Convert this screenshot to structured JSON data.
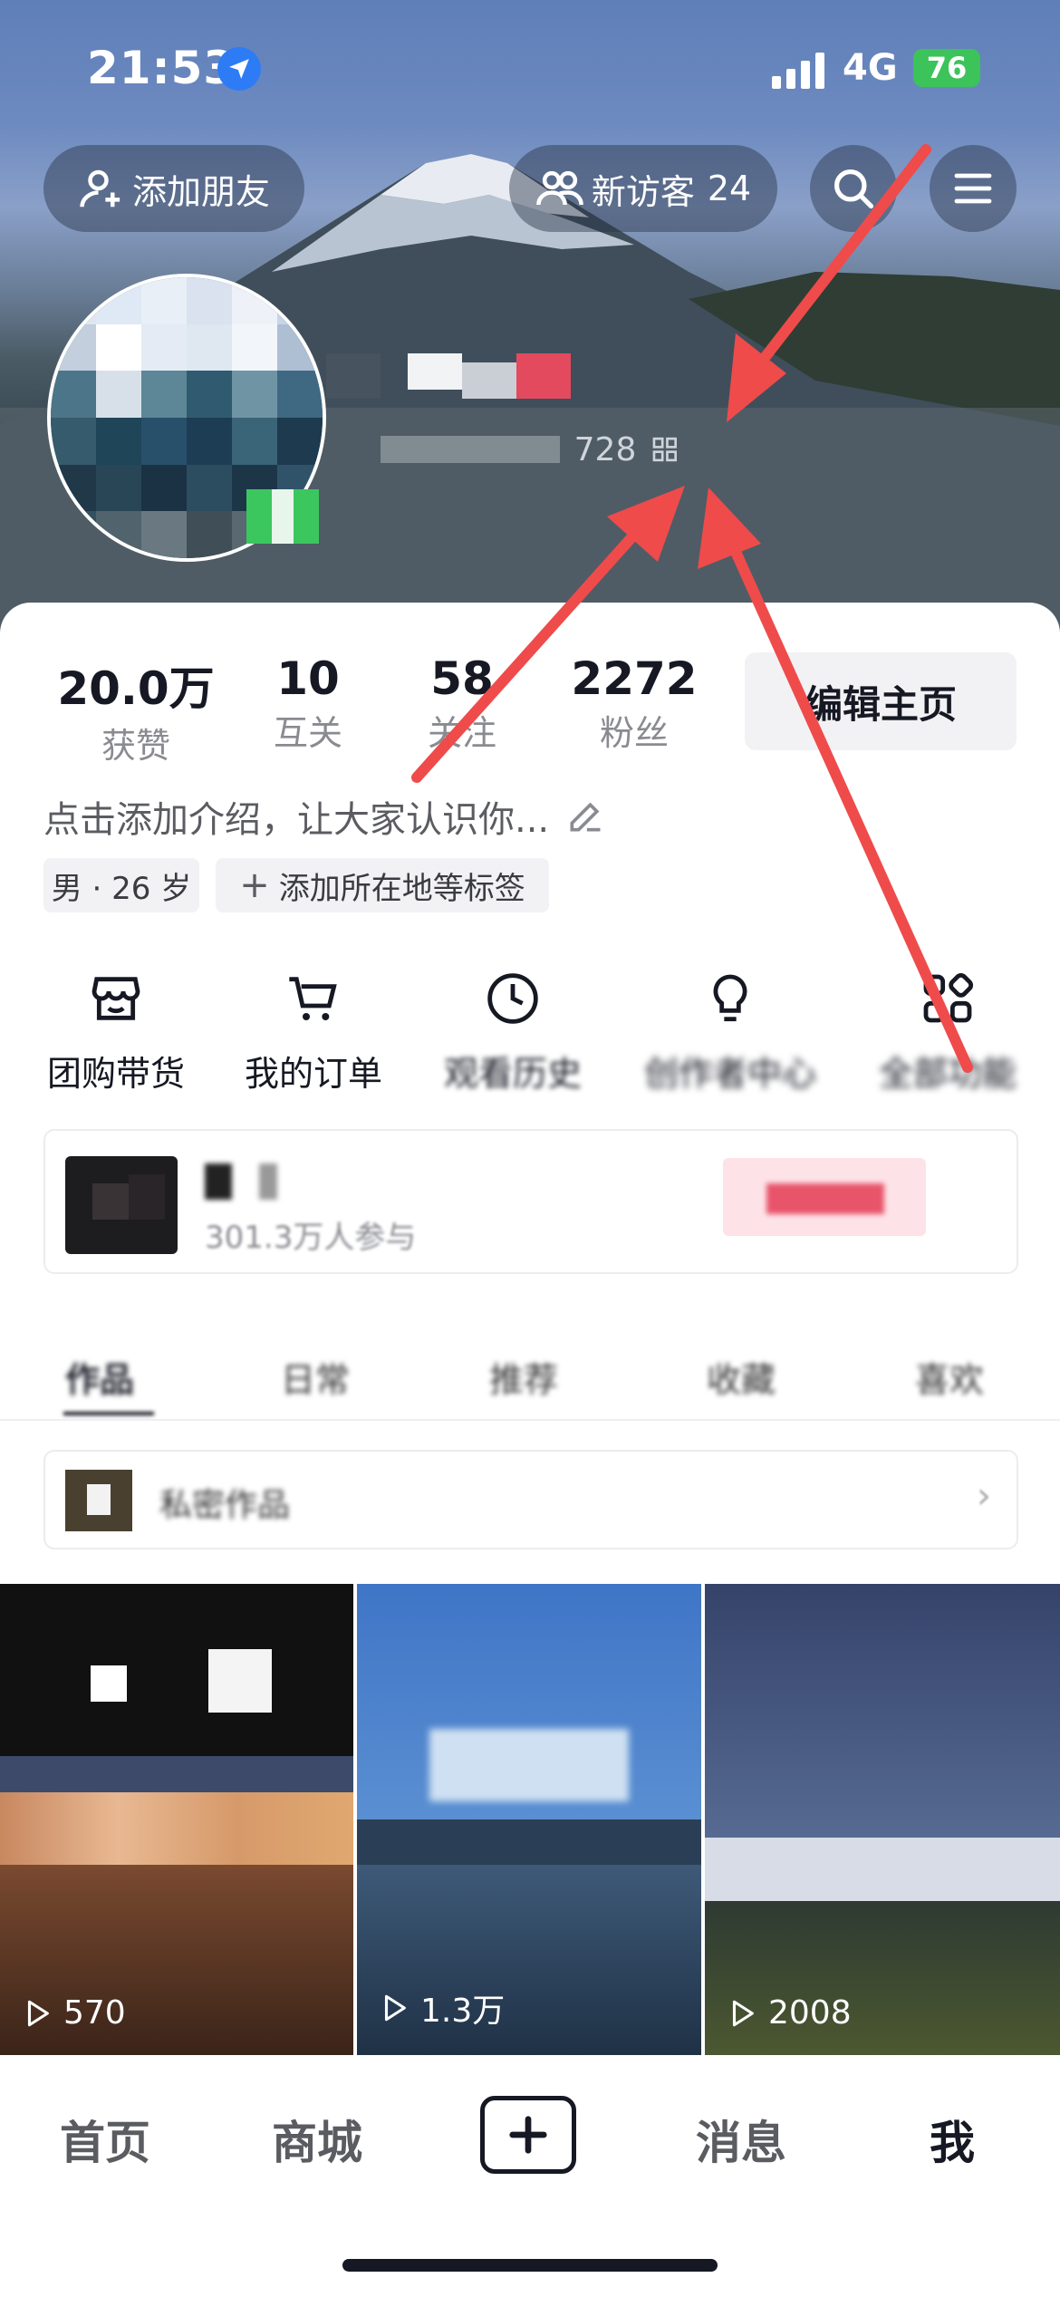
{
  "status_bar": {
    "time": "21:53",
    "signal": "4G",
    "battery": "76"
  },
  "header": {
    "add_friend_label": "添加朋友",
    "new_visitors_label": "新访客",
    "new_visitors_count": "24",
    "douyin_id_fragment": "728"
  },
  "stats": [
    {
      "value": "20.0万",
      "label": "获赞"
    },
    {
      "value": "10",
      "label": "互关"
    },
    {
      "value": "58",
      "label": "关注"
    },
    {
      "value": "2272",
      "label": "粉丝"
    }
  ],
  "edit_profile_label": "编辑主页",
  "bio_placeholder": "点击添加介绍，让大家认识你...",
  "tags": {
    "gender_age": "男 · 26 岁",
    "add_location": "添加所在地等标签"
  },
  "functions": [
    {
      "label": "团购带货",
      "icon": "store-icon"
    },
    {
      "label": "我的订单",
      "icon": "cart-icon"
    },
    {
      "label": "观看历史",
      "icon": "clock-icon"
    },
    {
      "label": "创作者中心",
      "icon": "bulb-icon"
    },
    {
      "label": "全部功能",
      "icon": "grid-icon"
    }
  ],
  "promo": {
    "participants": "301.3万人参与"
  },
  "content_tabs": [
    "作品",
    "日常",
    "推荐",
    "收藏",
    "喜欢"
  ],
  "private_works_label": "私密作品",
  "videos": [
    {
      "plays": "570"
    },
    {
      "plays": "1.3万"
    },
    {
      "plays": "2008"
    }
  ],
  "bottom_nav": [
    "首页",
    "商城",
    "消息",
    "我"
  ],
  "colors": {
    "annotation_arrow": "#ef4b4b",
    "accent": "#fe2c55"
  }
}
